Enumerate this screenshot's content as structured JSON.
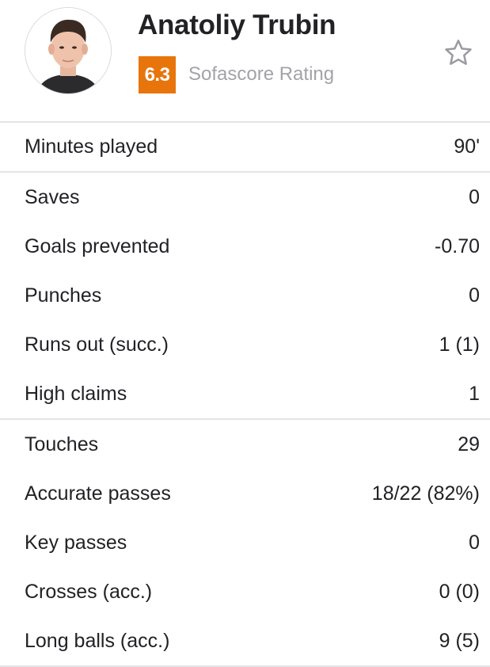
{
  "player": {
    "name": "Anatoliy Trubin",
    "rating": "6.3",
    "rating_label": "Sofascore Rating",
    "avatar": "player-photo",
    "favorite_icon": "star-outline-icon"
  },
  "colors": {
    "rating_badge": "#e8750c",
    "divider": "#e4e4e8",
    "text": "#222226",
    "muted": "#a3a3a8"
  },
  "groups": [
    {
      "stats": [
        {
          "label": "Minutes played",
          "value": "90'"
        }
      ]
    },
    {
      "stats": [
        {
          "label": "Saves",
          "value": "0"
        },
        {
          "label": "Goals prevented",
          "value": "-0.70"
        },
        {
          "label": "Punches",
          "value": "0"
        },
        {
          "label": "Runs out (succ.)",
          "value": "1 (1)"
        },
        {
          "label": "High claims",
          "value": "1"
        }
      ]
    },
    {
      "stats": [
        {
          "label": "Touches",
          "value": "29"
        },
        {
          "label": "Accurate passes",
          "value": "18/22 (82%)"
        },
        {
          "label": "Key passes",
          "value": "0"
        },
        {
          "label": "Crosses (acc.)",
          "value": "0 (0)"
        },
        {
          "label": "Long balls (acc.)",
          "value": "9 (5)"
        }
      ]
    }
  ]
}
